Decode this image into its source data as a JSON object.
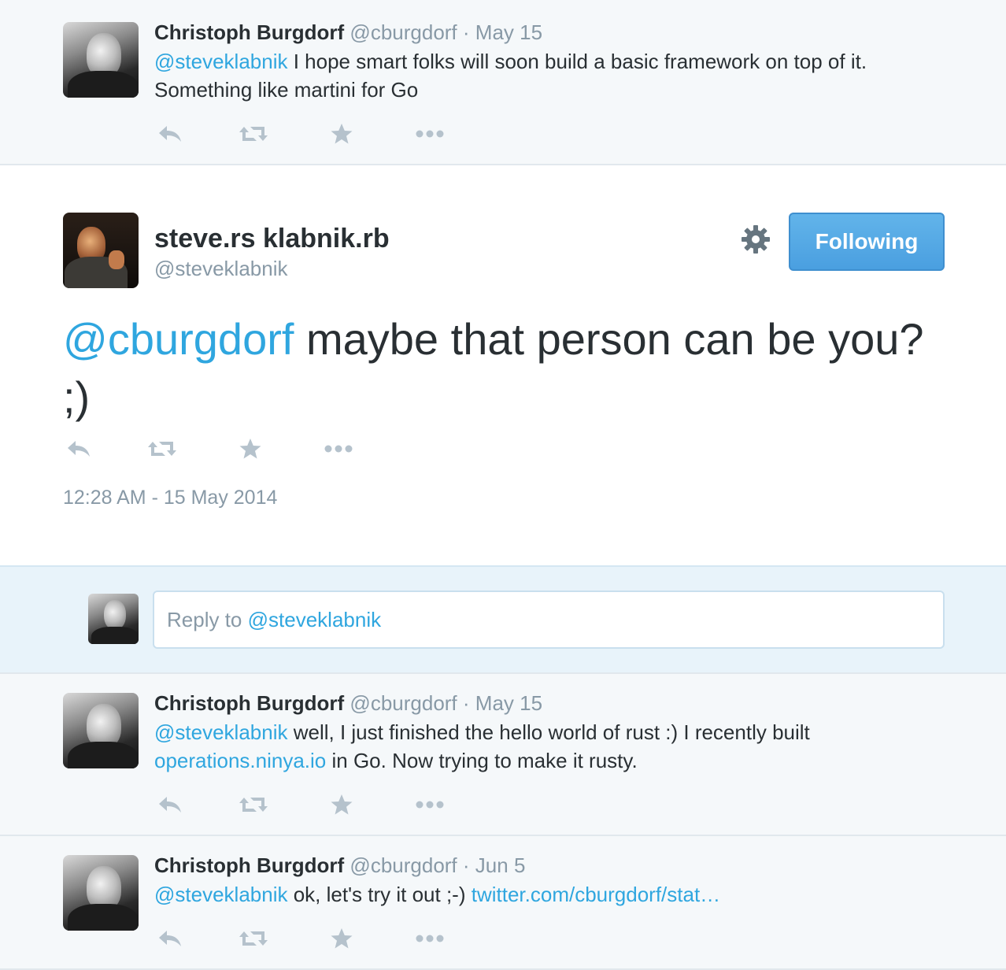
{
  "colors": {
    "link": "#2fa6df",
    "muted": "#8899a6",
    "text": "#292f33",
    "follow_button": "#55acee",
    "reply_bg": "#f5f8fa"
  },
  "replies_above": [
    {
      "fullname": "Christoph Burgdorf",
      "handle": "@cburgdorf",
      "sep": "·",
      "time": "May 15",
      "mention": "@steveklabnik",
      "text": " I hope smart folks will soon build a basic framework on top of it. Something like martini for Go"
    }
  ],
  "main_tweet": {
    "fullname": "steve.rs klabnik.rb",
    "handle": "@steveklabnik",
    "follow_label": "Following",
    "mention": "@cburgdorf",
    "text": " maybe that person can be you? ;)",
    "timestamp": "12:28 AM - 15 May 2014"
  },
  "reply_box": {
    "prefix": "Reply to ",
    "mention": "@steveklabnik"
  },
  "replies_below": [
    {
      "fullname": "Christoph Burgdorf",
      "handle": "@cburgdorf",
      "sep": "·",
      "time": "May 15",
      "mention": "@steveklabnik",
      "text_a": " well, I just finished the hello world of rust :) I recently built ",
      "link": "operations.ninya.io",
      "text_b": " in Go. Now trying to make it rusty."
    },
    {
      "fullname": "Christoph Burgdorf",
      "handle": "@cburgdorf",
      "sep": "·",
      "time": "Jun 5",
      "mention": "@steveklabnik",
      "text_a": " ok, let's try it out ;-) ",
      "link": "twitter.com/cburgdorf/stat…"
    }
  ],
  "icons": [
    "reply-icon",
    "retweet-icon",
    "favorite-icon",
    "more-icon",
    "gear-icon"
  ]
}
